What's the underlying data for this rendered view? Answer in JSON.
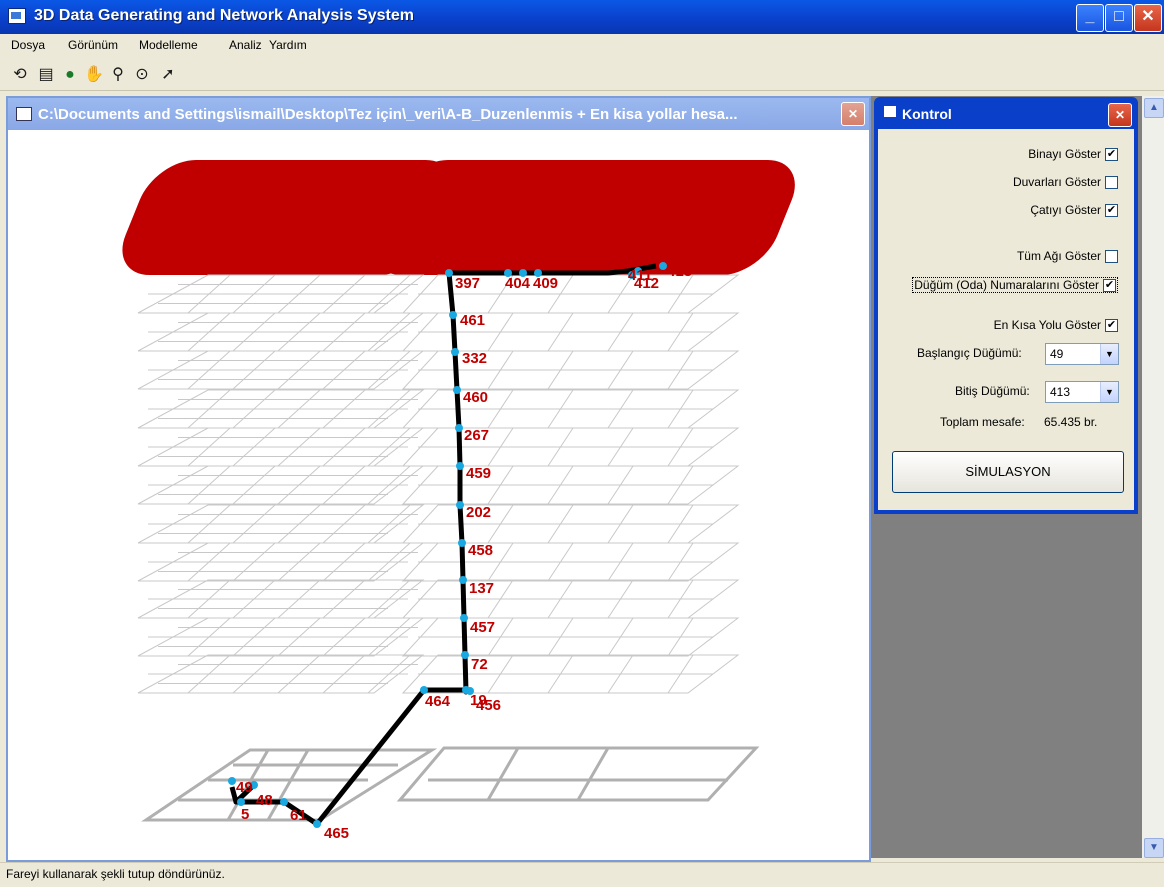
{
  "window": {
    "title": "3D Data Generating and Network Analysis System"
  },
  "menu": {
    "items": [
      "Dosya",
      "Görünüm",
      "Modelleme",
      "Analiz",
      "Yardım"
    ]
  },
  "toolbar": {
    "icons": [
      "rotate-icon",
      "layers-icon",
      "globe-icon",
      "hand-pan-icon",
      "zoom-icon",
      "orbit-icon",
      "select-pointer-icon"
    ]
  },
  "child": {
    "title": "C:\\Documents and Settings\\ismail\\Desktop\\Tez için\\_veri\\A-B_Duzenlenmis + En kisa yollar hesa..."
  },
  "control": {
    "title": "Kontrol",
    "binayi": "Binayı Göster",
    "binayi_checked": true,
    "duvarlari": "Duvarları Göster",
    "duvarlari_checked": false,
    "catiyi": "Çatıyı Göster",
    "catiyi_checked": true,
    "tum_agi": "Tüm Ağı Göster",
    "tum_agi_checked": false,
    "dugum": "Düğüm (Oda) Numaralarını Göster",
    "dugum_checked": true,
    "en_kisa": "En Kısa Yolu Göster",
    "en_kisa_checked": true,
    "start_label": "Başlangıç Düğümü:",
    "start_value": "49",
    "end_label": "Bitiş Düğümü:",
    "end_value": "413",
    "distance_label": "Toplam mesafe:",
    "distance_value": "65.435 br.",
    "sim_button": "SİMULASYON"
  },
  "route_labels": {
    "n397": "397",
    "n404": "404",
    "n409": "409",
    "n411": "411",
    "n412": "412",
    "n413": "413",
    "n461": "461",
    "n332": "332",
    "n460": "460",
    "n267": "267",
    "n459": "459",
    "n202": "202",
    "n458": "458",
    "n137": "137",
    "n457": "457",
    "n72": "72",
    "n464": "464",
    "n19": "19",
    "n456": "456",
    "n465": "465",
    "n61": "61",
    "n5": "5",
    "n48": "48",
    "n49": "49"
  },
  "status": {
    "text": "Fareyi kullanarak şekli tutup döndürünüz."
  }
}
